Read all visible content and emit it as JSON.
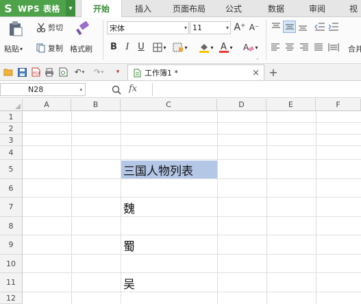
{
  "app": {
    "logo": "S",
    "name": "WPS 表格",
    "menu_caret": "▾"
  },
  "ribbon_tabs": [
    "开始",
    "插入",
    "页面布局",
    "公式",
    "数据",
    "审阅",
    "视"
  ],
  "active_tab": "开始",
  "clipboard": {
    "paste": "粘贴",
    "cut": "剪切",
    "copy": "复制",
    "format_painter": "格式刷"
  },
  "font": {
    "family": "宋体",
    "size": "11"
  },
  "format_buttons": {
    "bold": "B",
    "italic": "I",
    "underline": "U",
    "grow": "A⁺",
    "shrink": "A⁻"
  },
  "right_group": {
    "merge_center": "合并"
  },
  "document_tab": {
    "title": "工作簿1 *",
    "close": "×",
    "new_tab": "+"
  },
  "formula_bar": {
    "name_box": "N28",
    "fx": "fx",
    "value": ""
  },
  "columns": [
    "A",
    "B",
    "C",
    "D",
    "E",
    "F"
  ],
  "rows": [
    "1",
    "2",
    "3",
    "4",
    "5",
    "6",
    "7",
    "8",
    "9",
    "10",
    "11",
    "12"
  ],
  "cells": {
    "C5": "三国人物列表",
    "C7": "魏",
    "C9": "蜀",
    "C11": "吴"
  },
  "colors": {
    "brand_green": "#4da24a",
    "active_tab_text": "#3a8a36",
    "selection_fill": "#b4c7e7",
    "font_color_bar": "#e53935",
    "fill_color_bar": "#f5c400"
  }
}
